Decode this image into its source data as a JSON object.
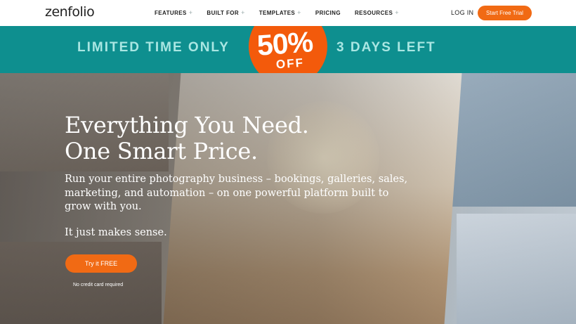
{
  "nav": {
    "logo": "zenfolio",
    "links": [
      {
        "label": "FEATURES",
        "has_menu": true
      },
      {
        "label": "BUILT FOR",
        "has_menu": true
      },
      {
        "label": "TEMPLATES",
        "has_menu": true
      },
      {
        "label": "PRICING",
        "has_menu": false
      },
      {
        "label": "RESOURCES",
        "has_menu": true
      }
    ],
    "plus_symbol": "+",
    "login": "LOG IN",
    "trial_button": "Start Free Trial"
  },
  "promo": {
    "left_text": "LIMITED TIME ONLY",
    "percent": "50%",
    "off": "OFF",
    "right_text": "3 DAYS LEFT"
  },
  "hero": {
    "headline_line1": "Everything You Need.",
    "headline_line2": "One Smart Price.",
    "subtext": "Run your entire photography business – bookings, galleries, sales, marketing, and automation – on one powerful platform built to grow with you.",
    "tagline": "It just makes sense.",
    "cta_label": "Try it FREE",
    "no_card": "No credit card required"
  },
  "colors": {
    "accent": "#f16a14",
    "promo_bg": "#0e8f8f",
    "promo_text": "#a9e6e2"
  }
}
